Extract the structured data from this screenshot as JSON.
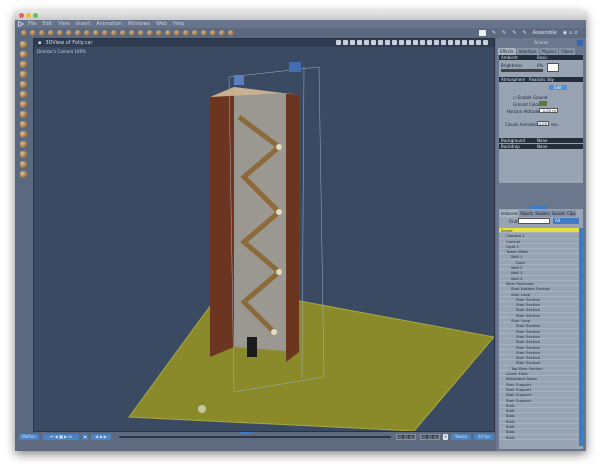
{
  "window": {
    "title_controls": [
      "close",
      "minimize",
      "zoom"
    ]
  },
  "menu": [
    "File",
    "Edit",
    "View",
    "Insert",
    "Animation",
    "Windows",
    "Web",
    "Help"
  ],
  "room": "Assemble",
  "viewport": {
    "title": "3DView of Folly.car",
    "camera": "Director's Camera 100%"
  },
  "scene_panel": {
    "title": "Scene",
    "tabs": [
      "Effects",
      "Interface",
      "Physics",
      "Filters"
    ],
    "ambient": {
      "label": "Ambient",
      "mode": "Basic",
      "brightness_label": "Brightness",
      "brightness_value": "0%"
    },
    "atmosphere": {
      "label": "Atmosphere",
      "mode": "Realistic Sky",
      "edit_label": "Edit",
      "enable_ground": "Enable Ground",
      "enable_ground_checked": false,
      "ground_color_label": "Ground Color",
      "ground_color": "#5a7a3a",
      "horizon_label": "Horizon Altitude",
      "horizon_value": "0.00 m",
      "clouds_label": "Clouds Animation",
      "clouds_value": "0.00",
      "clouds_unit": "sec."
    },
    "background": {
      "label": "Background",
      "mode": "None"
    },
    "backdrop": {
      "label": "Backdrop",
      "mode": "None"
    }
  },
  "browser": {
    "tabs": [
      "Instances",
      "Objects",
      "Shaders",
      "Sounds",
      "Clips"
    ],
    "find_label": "Find:",
    "find_value": "",
    "filter": "All",
    "tree": [
      {
        "label": "Scene",
        "depth": 0,
        "selected": true
      },
      {
        "label": "Camera 1",
        "depth": 1
      },
      {
        "label": "Conical",
        "depth": 1
      },
      {
        "label": "Light 1",
        "depth": 1
      },
      {
        "label": "Tower Walls",
        "depth": 1
      },
      {
        "label": "Wall 1",
        "depth": 2
      },
      {
        "label": "Door",
        "depth": 3
      },
      {
        "label": "Wall 2",
        "depth": 2
      },
      {
        "label": "Wall 3",
        "depth": 2
      },
      {
        "label": "Wall 4",
        "depth": 2
      },
      {
        "label": "Main Staircase",
        "depth": 1
      },
      {
        "label": "Stair Bottom Section",
        "depth": 2
      },
      {
        "label": "Stair Loop",
        "depth": 2
      },
      {
        "label": "Stair Section",
        "depth": 3
      },
      {
        "label": "Stair Section",
        "depth": 3
      },
      {
        "label": "Stair Section",
        "depth": 3
      },
      {
        "label": "Stair Section",
        "depth": 3
      },
      {
        "label": "Stair Loop",
        "depth": 2
      },
      {
        "label": "Stair Section",
        "depth": 3
      },
      {
        "label": "Stair Section",
        "depth": 3
      },
      {
        "label": "Stair Section",
        "depth": 3
      },
      {
        "label": "Stair Section",
        "depth": 3
      },
      {
        "label": "Stair Section",
        "depth": 3
      },
      {
        "label": "Stair Section",
        "depth": 3
      },
      {
        "label": "Stair Section",
        "depth": 3
      },
      {
        "label": "Stair Section",
        "depth": 3
      },
      {
        "label": "Top Stair Section",
        "depth": 2
      },
      {
        "label": "Lower Floor",
        "depth": 1
      },
      {
        "label": "Belvedere Room",
        "depth": 1
      },
      {
        "label": "Stair Support",
        "depth": 1
      },
      {
        "label": "Stair Support",
        "depth": 1
      },
      {
        "label": "Stair Support",
        "depth": 1
      },
      {
        "label": "Stair Support",
        "depth": 1
      },
      {
        "label": "Bulb",
        "depth": 1
      },
      {
        "label": "Bulb",
        "depth": 1
      },
      {
        "label": "Bulb",
        "depth": 1
      },
      {
        "label": "Bulb",
        "depth": 1
      },
      {
        "label": "Bulb",
        "depth": 1
      },
      {
        "label": "Bulb",
        "depth": 1
      },
      {
        "label": "Bulb",
        "depth": 1
      }
    ]
  },
  "timeline": {
    "mode": "Motion",
    "time_current": "00:00:00",
    "time_end": "00:00:00",
    "tween": "Tween",
    "fps": "24 fps"
  },
  "colors": {
    "viewport_bg": "#3b4a63",
    "ground": "#8a8a2a",
    "selection": "#e5e23c",
    "accent": "#4f8fd2"
  }
}
